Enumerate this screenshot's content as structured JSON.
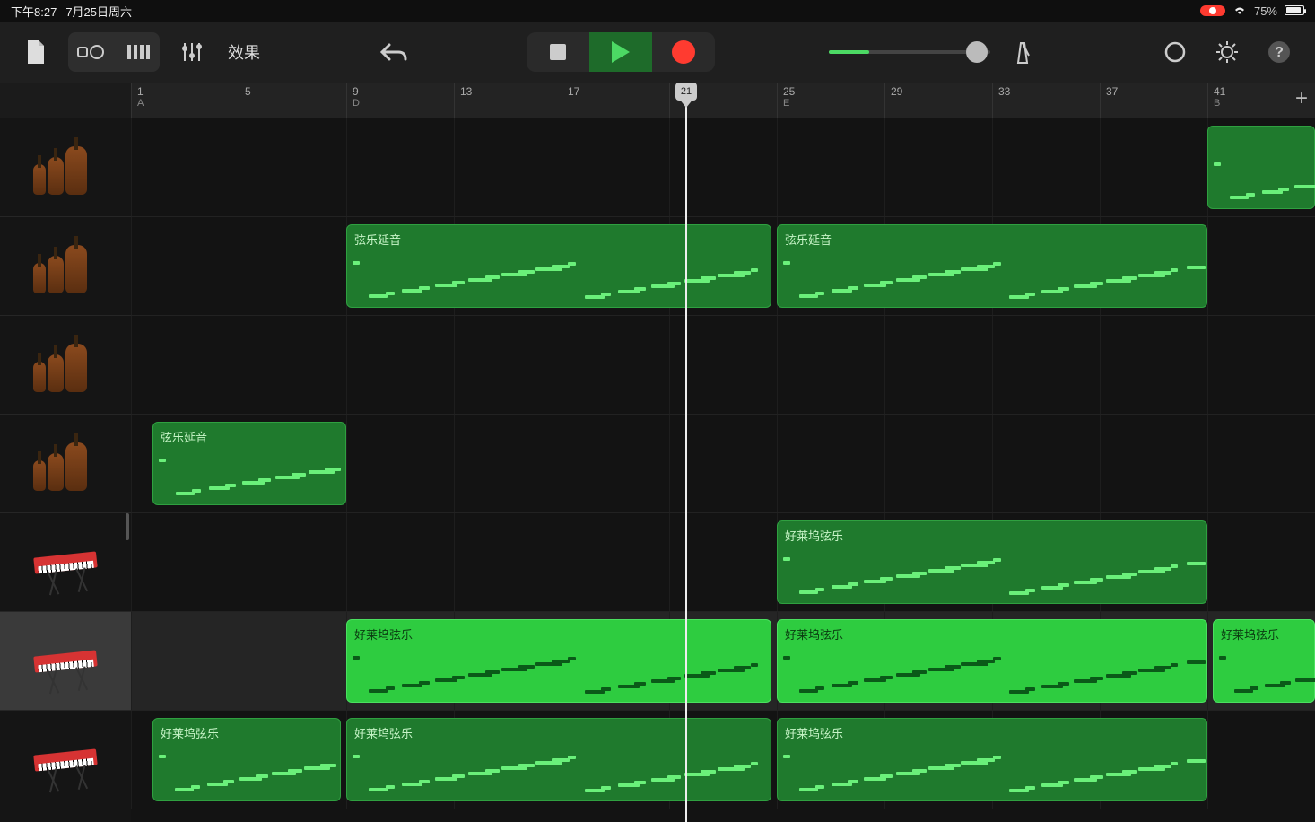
{
  "status": {
    "time": "下午8:27",
    "date": "7月25日周六",
    "battery_pct": "75%"
  },
  "toolbar": {
    "fx_label": "效果"
  },
  "ruler": [
    {
      "bar": "1",
      "marker": "A"
    },
    {
      "bar": "5",
      "marker": ""
    },
    {
      "bar": "9",
      "marker": "D"
    },
    {
      "bar": "13",
      "marker": ""
    },
    {
      "bar": "17",
      "marker": ""
    },
    {
      "bar": "21",
      "marker": ""
    },
    {
      "bar": "25",
      "marker": "E"
    },
    {
      "bar": "29",
      "marker": ""
    },
    {
      "bar": "33",
      "marker": ""
    },
    {
      "bar": "37",
      "marker": ""
    },
    {
      "bar": "41",
      "marker": "B"
    }
  ],
  "playhead_bar": "21",
  "tracks": [
    {
      "instrument": "strings",
      "selected": false
    },
    {
      "instrument": "strings",
      "selected": false
    },
    {
      "instrument": "strings",
      "selected": false
    },
    {
      "instrument": "strings",
      "selected": false
    },
    {
      "instrument": "keyboard",
      "selected": false
    },
    {
      "instrument": "keyboard",
      "selected": true
    },
    {
      "instrument": "keyboard",
      "selected": false
    }
  ],
  "regions": {
    "t0": [
      {
        "label": "",
        "start": 10,
        "end": 11,
        "bright": false
      }
    ],
    "t1": [
      {
        "label": "弦乐延音",
        "start": 2,
        "end": 5.95,
        "bright": false
      },
      {
        "label": "弦乐延音",
        "start": 6,
        "end": 10,
        "bright": false
      }
    ],
    "t3": [
      {
        "label": "弦乐延音",
        "start": 0.2,
        "end": 2,
        "bright": false
      }
    ],
    "t4": [
      {
        "label": "好莱坞弦乐",
        "start": 6,
        "end": 10,
        "bright": false
      }
    ],
    "t5": [
      {
        "label": "好莱坞弦乐",
        "start": 2,
        "end": 5.95,
        "bright": true
      },
      {
        "label": "好莱坞弦乐",
        "start": 6,
        "end": 10,
        "bright": true
      },
      {
        "label": "好莱坞弦乐",
        "start": 10.05,
        "end": 11,
        "bright": true
      }
    ],
    "t6": [
      {
        "label": "好莱坞弦乐",
        "start": 0.2,
        "end": 1.95,
        "bright": false
      },
      {
        "label": "好莱坞弦乐",
        "start": 2,
        "end": 5.95,
        "bright": false
      },
      {
        "label": "好莱坞弦乐",
        "start": 6,
        "end": 10,
        "bright": false
      }
    ]
  }
}
